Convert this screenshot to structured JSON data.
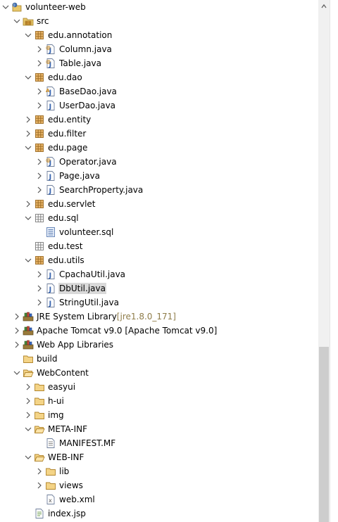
{
  "tree": [
    {
      "label": "volunteer-web",
      "level": 0,
      "chev": "down",
      "icon": "project"
    },
    {
      "label": "src",
      "level": 1,
      "chev": "down",
      "icon": "source-folder"
    },
    {
      "label": "edu.annotation",
      "level": 2,
      "chev": "down",
      "icon": "package"
    },
    {
      "label": "Column.java",
      "level": 3,
      "chev": "right",
      "icon": "annotation-file"
    },
    {
      "label": "Table.java",
      "level": 3,
      "chev": "right",
      "icon": "annotation-file"
    },
    {
      "label": "edu.dao",
      "level": 2,
      "chev": "down",
      "icon": "package"
    },
    {
      "label": "BaseDao.java",
      "level": 3,
      "chev": "right",
      "icon": "abstract-java-file"
    },
    {
      "label": "UserDao.java",
      "level": 3,
      "chev": "right",
      "icon": "java-file"
    },
    {
      "label": "edu.entity",
      "level": 2,
      "chev": "right",
      "icon": "package"
    },
    {
      "label": "edu.filter",
      "level": 2,
      "chev": "right",
      "icon": "package"
    },
    {
      "label": "edu.page",
      "level": 2,
      "chev": "down",
      "icon": "package"
    },
    {
      "label": "Operator.java",
      "level": 3,
      "chev": "right",
      "icon": "annotation-file"
    },
    {
      "label": "Page.java",
      "level": 3,
      "chev": "right",
      "icon": "java-file"
    },
    {
      "label": "SearchProperty.java",
      "level": 3,
      "chev": "right",
      "icon": "java-file"
    },
    {
      "label": "edu.servlet",
      "level": 2,
      "chev": "right",
      "icon": "package"
    },
    {
      "label": "edu.sql",
      "level": 2,
      "chev": "down",
      "icon": "package-empty"
    },
    {
      "label": "volunteer.sql",
      "level": 3,
      "chev": "none",
      "icon": "sql-file"
    },
    {
      "label": "edu.test",
      "level": 2,
      "chev": "none",
      "icon": "package-empty"
    },
    {
      "label": "edu.utils",
      "level": 2,
      "chev": "down",
      "icon": "package"
    },
    {
      "label": "CpachaUtil.java",
      "level": 3,
      "chev": "right",
      "icon": "java-file"
    },
    {
      "label": "DbUtil.java",
      "level": 3,
      "chev": "right",
      "icon": "java-file",
      "selected": true
    },
    {
      "label": "StringUtil.java",
      "level": 3,
      "chev": "right",
      "icon": "java-file"
    },
    {
      "label": "JRE System Library",
      "decor": "[jre1.8.0_171]",
      "level": 1,
      "chev": "right",
      "icon": "library"
    },
    {
      "label": "Apache Tomcat v9.0 [Apache Tomcat v9.0]",
      "level": 1,
      "chev": "right",
      "icon": "library"
    },
    {
      "label": "Web App Libraries",
      "level": 1,
      "chev": "right",
      "icon": "library"
    },
    {
      "label": "build",
      "level": 1,
      "chev": "none",
      "icon": "folder"
    },
    {
      "label": "WebContent",
      "level": 1,
      "chev": "down",
      "icon": "folder-open"
    },
    {
      "label": "easyui",
      "level": 2,
      "chev": "right",
      "icon": "folder"
    },
    {
      "label": "h-ui",
      "level": 2,
      "chev": "right",
      "icon": "folder"
    },
    {
      "label": "img",
      "level": 2,
      "chev": "right",
      "icon": "folder"
    },
    {
      "label": "META-INF",
      "level": 2,
      "chev": "down",
      "icon": "folder-open"
    },
    {
      "label": "MANIFEST.MF",
      "level": 3,
      "chev": "none",
      "icon": "text-file"
    },
    {
      "label": "WEB-INF",
      "level": 2,
      "chev": "down",
      "icon": "folder-open"
    },
    {
      "label": "lib",
      "level": 3,
      "chev": "right",
      "icon": "folder"
    },
    {
      "label": "views",
      "level": 3,
      "chev": "right",
      "icon": "folder"
    },
    {
      "label": "web.xml",
      "level": 3,
      "chev": "none",
      "icon": "xml-file"
    },
    {
      "label": "index.jsp",
      "level": 2,
      "chev": "none",
      "icon": "jsp-file"
    }
  ],
  "scrollbar": {
    "position_fraction": 0.66,
    "visible_fraction": 0.34
  }
}
